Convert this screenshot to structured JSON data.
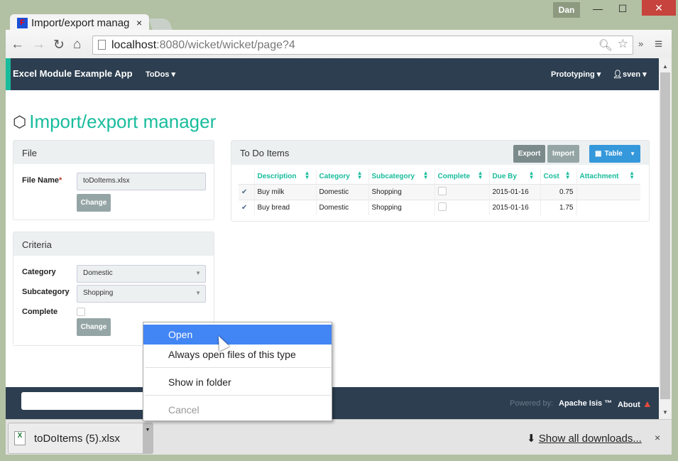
{
  "window": {
    "user": "Dan",
    "minimize": "—",
    "maximize": "☐",
    "close": "✕"
  },
  "tab": {
    "title": "Import/export manag",
    "close": "×"
  },
  "toolbar": {
    "back": "←",
    "forward": "→",
    "reload": "↻",
    "home": "⌂",
    "url_host": "localhost",
    "url_rest": ":8080/wicket/wicket/page?4",
    "more": "»",
    "menu": "≡"
  },
  "navbar": {
    "brand": "Excel Module Example App",
    "menu1": "ToDos",
    "menu2": "Prototyping",
    "user": "sven"
  },
  "page_title": "Import/export manager",
  "file_panel": {
    "title": "File",
    "label": "File Name",
    "required": "*",
    "value": "toDoItems.xlsx",
    "button": "Change"
  },
  "criteria_panel": {
    "title": "Criteria",
    "category_label": "Category",
    "category_value": "Domestic",
    "subcategory_label": "Subcategory",
    "subcategory_value": "Shopping",
    "complete_label": "Complete",
    "button": "Change"
  },
  "todo_panel": {
    "title": "To Do Items",
    "export": "Export",
    "import": "Import",
    "view": "Table",
    "columns": [
      "Description",
      "Category",
      "Subcategory",
      "Complete",
      "Due By",
      "Cost",
      "Attachment"
    ],
    "rows": [
      {
        "description": "Buy milk",
        "category": "Domestic",
        "subcategory": "Shopping",
        "complete": false,
        "due_by": "2015-01-16",
        "cost": "0.75",
        "attachment": ""
      },
      {
        "description": "Buy bread",
        "category": "Domestic",
        "subcategory": "Shopping",
        "complete": false,
        "due_by": "2015-01-16",
        "cost": "1.75",
        "attachment": ""
      }
    ]
  },
  "footer": {
    "powered_by": "Powered by:",
    "isis": "Apache Isis ™",
    "about": "About"
  },
  "context_menu": {
    "items": [
      "Open",
      "Always open files of this type",
      "Show in folder",
      "Cancel"
    ]
  },
  "downloads": {
    "file": "toDoItems (5).xlsx",
    "show_all": "Show all downloads...",
    "close": "×"
  },
  "colors": {
    "accent": "#18bc9c",
    "navbar": "#2c3e50",
    "primary": "#3498db",
    "menu_highlight": "#4285f4"
  }
}
